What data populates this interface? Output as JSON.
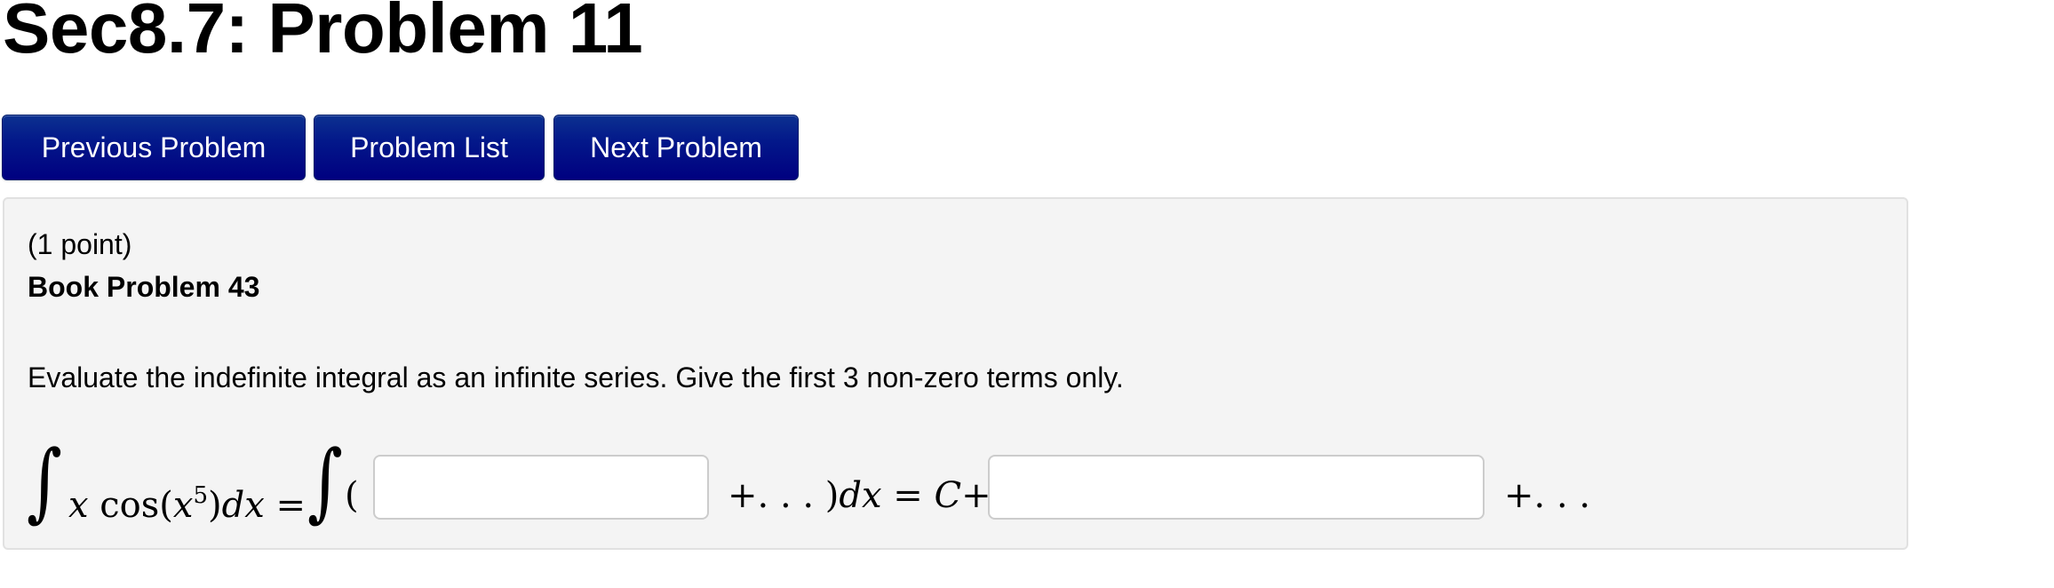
{
  "page": {
    "title": "Sec8.7: Problem 11"
  },
  "nav": {
    "previous_label": "Previous Problem",
    "list_label": "Problem List",
    "next_label": "Next Problem",
    "button_color": "#000080"
  },
  "problem": {
    "points": "(1 point)",
    "heading": "Book Problem 43",
    "instructions": "Evaluate the indefinite integral as an infinite series. Give the first 3 non-zero terms only.",
    "equation": {
      "integral_symbol": "∫",
      "lhs_x": "x",
      "lhs_cos": " cos(",
      "lhs_x2": "x",
      "lhs_exp": "5",
      "lhs_close": ")",
      "lhs_dx": "dx",
      "lhs_eq": " = ",
      "open_paren": "(",
      "mid_text_plus": "+. . . )",
      "mid_dx": "dx",
      "mid_eq": " = ",
      "mid_C": "C",
      "mid_plus": "+",
      "tail": "+. . ."
    },
    "inputs": [
      {
        "value": "",
        "placeholder": ""
      },
      {
        "value": "",
        "placeholder": ""
      }
    ]
  }
}
